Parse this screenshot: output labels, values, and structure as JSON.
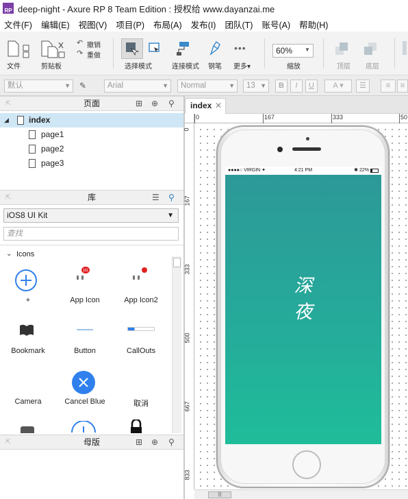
{
  "window": {
    "logo_text": "RP",
    "title": "deep-night - Axure RP 8 Team Edition : 授权给 www.dayanzai.me"
  },
  "menu": [
    "文件(F)",
    "编辑(E)",
    "视图(V)",
    "项目(P)",
    "布局(A)",
    "发布(I)",
    "团队(T)",
    "账号(A)",
    "帮助(H)"
  ],
  "toolbar": {
    "file": "文件",
    "clipboard": "剪贴板",
    "undo": "撤销",
    "redo": "重做",
    "select_mode": "选择模式",
    "connect_mode": "连接模式",
    "pen": "钢笔",
    "more": "更多▾",
    "zoom_value": "60%",
    "zoom_label": "缩放",
    "top": "顶层",
    "bottom": "底层"
  },
  "format": {
    "style": "默认",
    "font": "Arial",
    "weight": "Normal",
    "size": "13",
    "bold": "B",
    "italic": "I",
    "underline": "U"
  },
  "pages_panel": {
    "title": "页面",
    "items": [
      "index",
      "page1",
      "page2",
      "page3"
    ]
  },
  "library_panel": {
    "title": "库",
    "selected": "iOS8 UI Kit",
    "search_placeholder": "查找",
    "group": "Icons",
    "widgets": [
      "+",
      "App Icon",
      "App Icon2",
      "Bookmark",
      "Button",
      "CallOuts",
      "Camera",
      "Cancel Blue",
      "取消"
    ],
    "badge_value": "101"
  },
  "masters_panel": {
    "title": "母版"
  },
  "canvas": {
    "tab": "index",
    "h_ruler": [
      "0",
      "167",
      "333",
      "50"
    ],
    "v_ruler": [
      "0",
      "167",
      "333",
      "500",
      "667",
      "833"
    ]
  },
  "phone": {
    "carrier": "●●●●○ VIRGIN ✦",
    "time": "4:21 PM",
    "battery": "✱ 22%",
    "screen_title_line1": "深",
    "screen_title_line2": "夜"
  }
}
